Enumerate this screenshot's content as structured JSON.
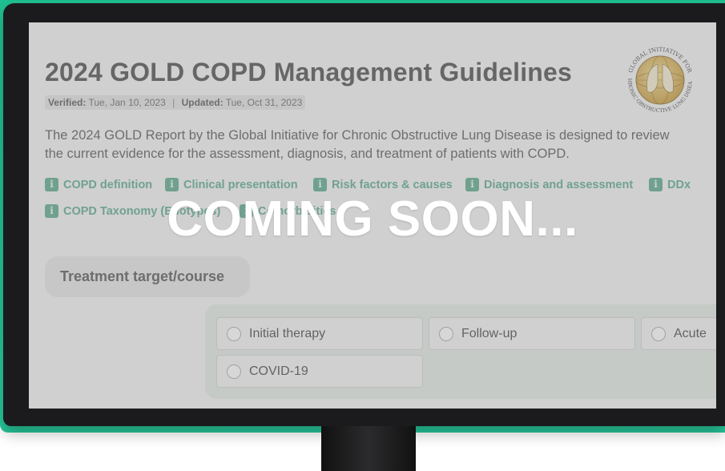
{
  "page": {
    "title": "2024 GOLD COPD Management Guidelines",
    "meta": {
      "verified_label": "Verified:",
      "verified_date": "Tue, Jan 10, 2023",
      "separator": "|",
      "updated_label": "Updated:",
      "updated_date": "Tue, Oct 31, 2023"
    },
    "description": "The 2024 GOLD Report by the Global Initiative for Chronic Obstructive Lung Disease is designed to review the current evidence for the assessment, diagnosis, and treatment of patients with COPD.",
    "logo": {
      "text_top": "GLOBAL INITIATIVE FOR",
      "text_bottom": "CHRONIC OBSTRUCTIVE LUNG DISEASE",
      "icon": "lungs-globe-icon"
    },
    "chips": [
      {
        "label": "COPD definition",
        "icon": "info-icon"
      },
      {
        "label": "Clinical presentation",
        "icon": "info-icon"
      },
      {
        "label": "Risk factors & causes",
        "icon": "info-icon"
      },
      {
        "label": "Diagnosis and assessment",
        "icon": "info-icon"
      },
      {
        "label": "DDx",
        "icon": "info-icon"
      },
      {
        "label": "COPD Taxonomy (Etiotypes)",
        "icon": "info-icon"
      },
      {
        "label": "Comorbidities",
        "icon": "info-icon"
      }
    ],
    "treatment_target": "Treatment target/course",
    "options": [
      "Initial therapy",
      "Follow-up",
      "Acute",
      "COVID-19"
    ],
    "overlay_text": "COMING SOON..."
  },
  "colors": {
    "accent": "#27c79a",
    "chip": "#5aa88c",
    "title": "#4a4a4a"
  }
}
